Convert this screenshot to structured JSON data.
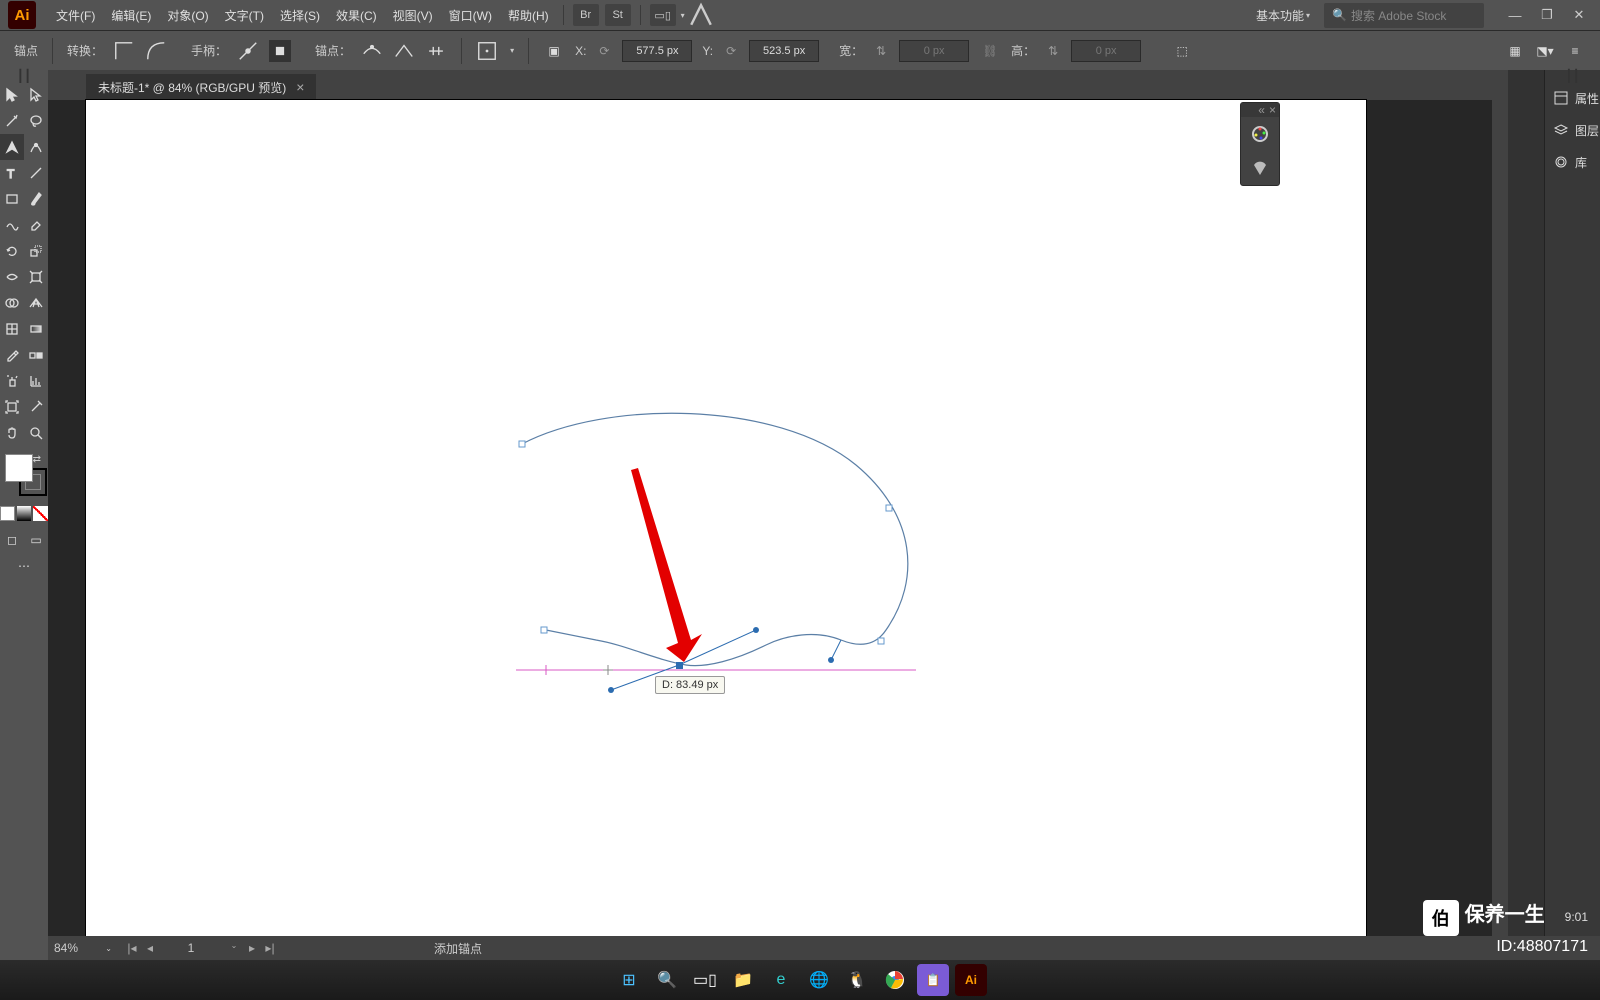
{
  "app": {
    "logo": "Ai"
  },
  "menu": {
    "file": "文件(F)",
    "edit": "编辑(E)",
    "object": "对象(O)",
    "type": "文字(T)",
    "select": "选择(S)",
    "effect": "效果(C)",
    "view": "视图(V)",
    "window": "窗口(W)",
    "help": "帮助(H)"
  },
  "workspace": {
    "label": "基本功能",
    "search_placeholder": "搜索 Adobe Stock"
  },
  "control": {
    "anchor_label": "锚点",
    "convert_label": "转换：",
    "handle_label": "手柄：",
    "anchors_label": "锚点：",
    "x_label": "X:",
    "x_value": "577.5 px",
    "y_label": "Y:",
    "y_value": "523.5 px",
    "w_label": "宽：",
    "w_value": "0 px",
    "h_label": "高：",
    "h_value": "0 px"
  },
  "document": {
    "tab_title": "未标题-1* @ 84% (RGB/GPU 预览)"
  },
  "tooltip": {
    "text": "D: 83.49 px"
  },
  "panels": {
    "properties": "属性",
    "layers": "图层",
    "libraries": "库"
  },
  "status": {
    "zoom": "84%",
    "artboard": "1",
    "mode": "添加锚点"
  },
  "watermark": {
    "brand": "保养一生",
    "id": "ID:48807171",
    "time": "9:01"
  }
}
